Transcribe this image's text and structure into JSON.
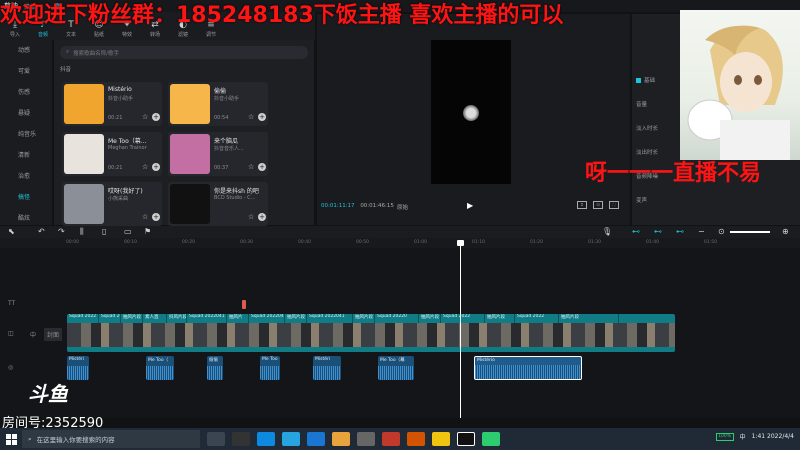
{
  "app": {
    "name": "剪映",
    "menu": "菜单"
  },
  "overlay": {
    "top_banner": "欢迎进下粉丝群：185248183下饭主播 喜欢主播的可以",
    "mid_banner": "呀一一一直播不易",
    "logo": "斗鱼",
    "room": "房间号:2352590"
  },
  "tools": [
    {
      "label": "导入",
      "icon": "import-icon",
      "glyph": "⤓"
    },
    {
      "label": "音频",
      "icon": "music-icon",
      "glyph": "♪",
      "active": true
    },
    {
      "label": "文本",
      "icon": "text-icon",
      "glyph": "T"
    },
    {
      "label": "贴纸",
      "icon": "sticker-icon",
      "glyph": "☺"
    },
    {
      "label": "特效",
      "icon": "effects-icon",
      "glyph": "✦"
    },
    {
      "label": "转场",
      "icon": "transition-icon",
      "glyph": "⇄"
    },
    {
      "label": "滤镜",
      "icon": "filter-icon",
      "glyph": "◐"
    },
    {
      "label": "调节",
      "icon": "adjust-icon",
      "glyph": "≡"
    }
  ],
  "categories": [
    "动感",
    "可爱",
    "伤感",
    "悬疑",
    "纯音乐",
    "清新",
    "治愈",
    "搞怪",
    "酷炫",
    "美食"
  ],
  "active_category": 7,
  "search_placeholder": "搜索歌曲名称/歌手",
  "section_label": "抖音",
  "songs": [
    {
      "title": "Mistério",
      "artist": "抖音小助手",
      "duration": "00:21",
      "cover": "#f0a62e"
    },
    {
      "title": "偷偷",
      "artist": "抖音小助手",
      "duration": "00:54",
      "cover": "#f7b64a"
    },
    {
      "title": "Me Too（幕...",
      "artist": "Meghan Trainor",
      "duration": "00:21",
      "cover": "#e8e3dc"
    },
    {
      "title": "来个脑瓜",
      "artist": "抖音音乐人...",
      "duration": "00:37",
      "cover": "#c46fa3"
    },
    {
      "title": "哎呀(我好了)",
      "artist": "小熊采曲",
      "duration": "",
      "cover": "#8b8f97"
    },
    {
      "title": "你是来抖sh 的吧",
      "artist": "BCD Studio - C...",
      "duration": "",
      "cover": "#111111"
    }
  ],
  "player": {
    "current_time": "00:01:11:17",
    "total_time": "00:01:46:15",
    "ratio": "原始",
    "play_icon": "play-icon"
  },
  "props": {
    "rows": [
      "基础",
      "音量",
      "淡入时长",
      "淡出时长",
      "音频降噪",
      "变声"
    ],
    "enable": "基础"
  },
  "timeline": {
    "ticks": [
      "00:00",
      "00:10",
      "00:20",
      "00:30",
      "00:40",
      "00:50",
      "01:00",
      "01:10",
      "01:20",
      "01:30",
      "01:40",
      "01:50"
    ],
    "track_labels": [
      "TT",
      "封面",
      "中"
    ],
    "video_clips": [
      "Squad 2022",
      "Squad 202",
      "抽风片段",
      "素人直",
      "抖风片段",
      "Squad 2022041",
      "抽风片",
      "Squad 2022041",
      "抽风片段",
      "Squad 2022041",
      "抽风片段",
      "Squad 20220",
      "抽风片段",
      "Squad 2022",
      "抽风片段",
      "Squad 2022",
      "抽风片段"
    ],
    "audio_clips": [
      {
        "name": "Mistéri",
        "selected": false
      },
      {
        "name": "Me Too（",
        "selected": false
      },
      {
        "name": "偷偷",
        "selected": false
      },
      {
        "name": "Me Too",
        "selected": false
      },
      {
        "name": "Mistéri",
        "selected": false
      },
      {
        "name": "Me Too（幕",
        "selected": false
      },
      {
        "name": "Mistério",
        "selected": true
      }
    ]
  },
  "taskbar": {
    "search_placeholder": "在这里输入你要搜索的内容",
    "battery": "100%",
    "ime": "中",
    "time": "1:41",
    "date": "2022/4/4"
  }
}
